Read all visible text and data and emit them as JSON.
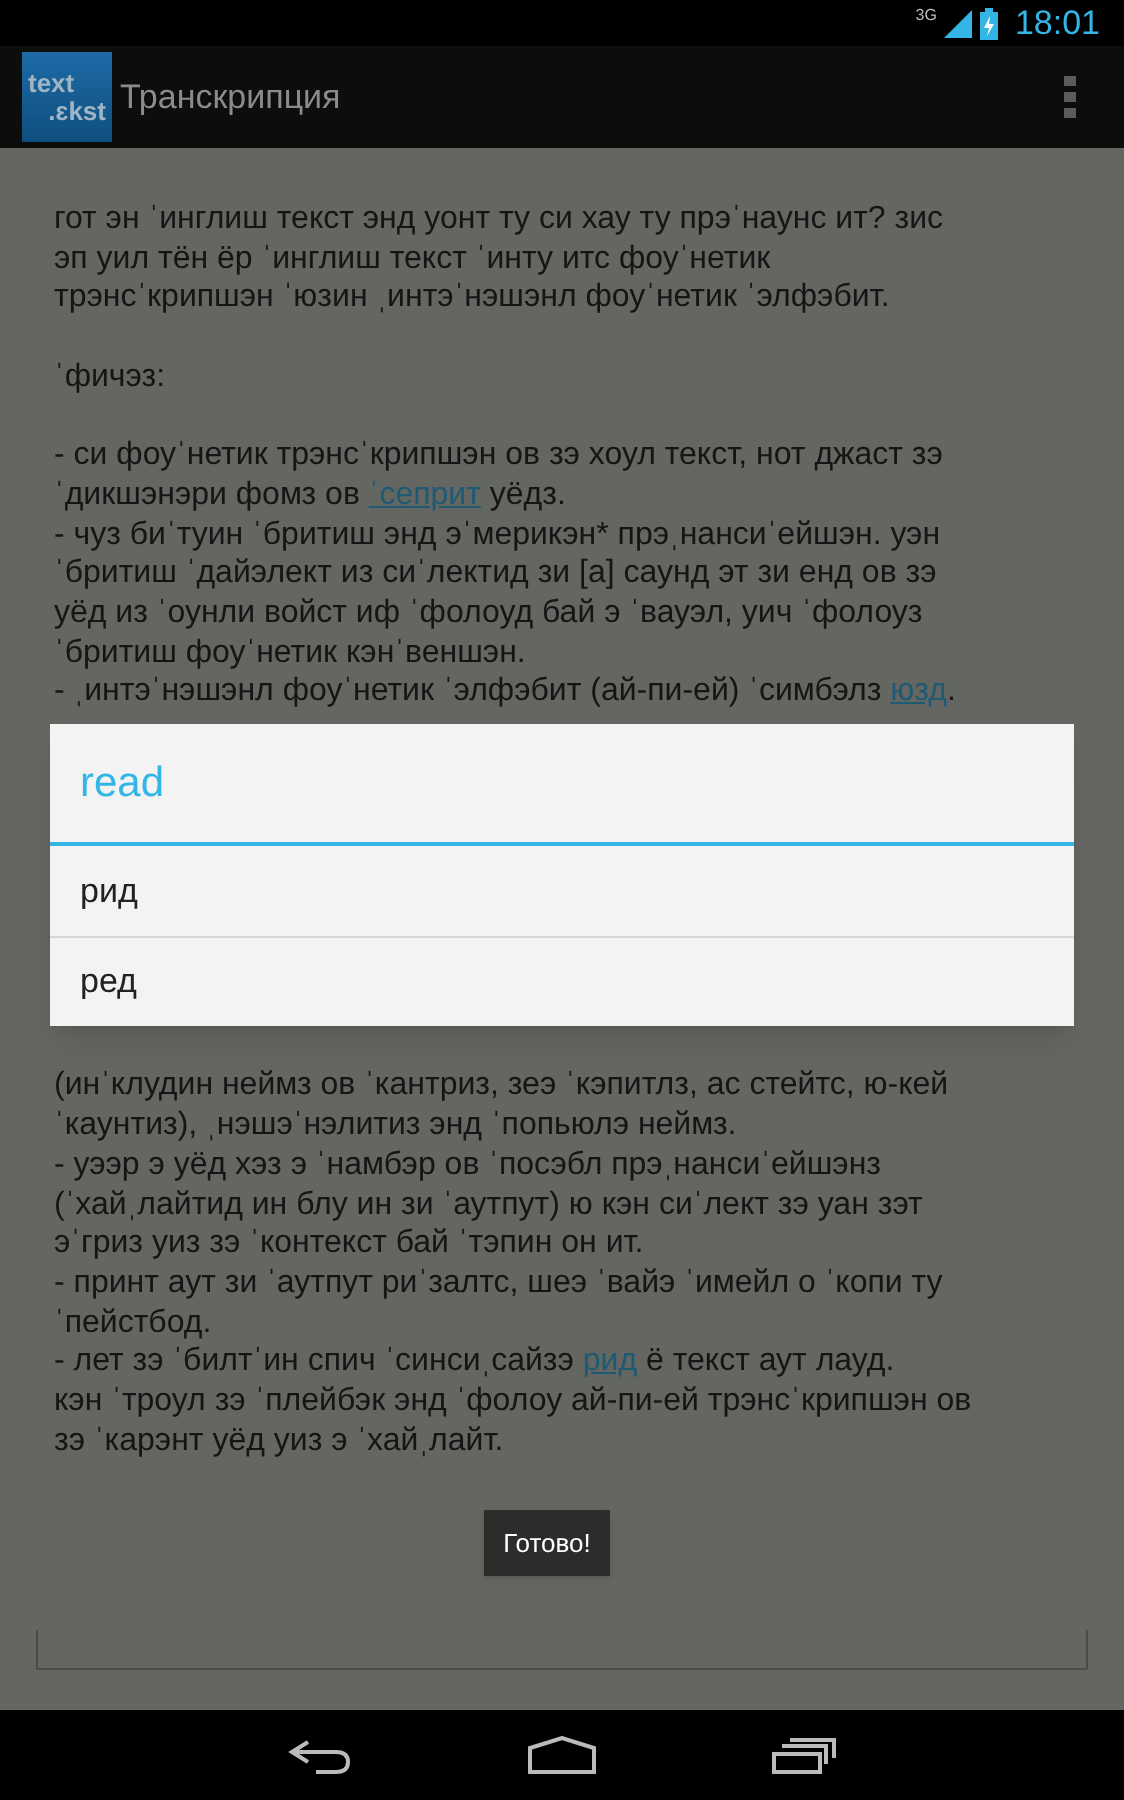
{
  "status_bar": {
    "network": "3G",
    "time": "18:01"
  },
  "action_bar": {
    "logo": [
      "text",
      ".ɛkst"
    ],
    "title": "Транскрипция"
  },
  "content": {
    "top_paragraphs": [
      [
        [
          {
            "kind": "text",
            "text": "гот эн ˈинглиш текст энд уонт ту си хау ту прэˈнаунс ит? зис"
          }
        ],
        [
          {
            "kind": "text",
            "text": "эп уил тён ёр ˈинглиш текст ˈинту итс фоуˈнетик"
          }
        ],
        [
          {
            "kind": "text",
            "text": "трэнсˈкрипшэн ˈюзин ˌинтэˈнэшэнл фоуˈнетик ˈэлфэбит."
          }
        ]
      ],
      [
        [
          {
            "kind": "text",
            "text": "ˈфичэз:"
          }
        ]
      ],
      [
        [
          {
            "kind": "text",
            "text": "- си фоуˈнетик трэнсˈкрипшэн ов зэ хоул текст, нот джаст зэ"
          }
        ],
        [
          {
            "kind": "text",
            "text": "ˈдикшэнэри фомз ов "
          },
          {
            "kind": "link",
            "text": "ˈсеприт"
          },
          {
            "kind": "text",
            "text": " уёдз."
          }
        ],
        [
          {
            "kind": "text",
            "text": "- чуз биˈтуин ˈбритиш энд эˈмерикэн* прэˌнансиˈейшэн. уэн"
          }
        ],
        [
          {
            "kind": "text",
            "text": "ˈбритиш ˈдайэлект из сиˈлектид зи [а] саунд эт зи енд ов зэ"
          }
        ],
        [
          {
            "kind": "text",
            "text": "уёд из ˈоунли войст иф ˈфолоуд бай э ˈвауэл, уич ˈфолоуз"
          }
        ],
        [
          {
            "kind": "text",
            "text": "ˈбритиш фоуˈнетик кэнˈвеншэн."
          }
        ],
        [
          {
            "kind": "text",
            "text": "- ˌинтэˈнэшэнл фоуˈнетик ˈэлфэбит (ай-пи-ей) ˈсимбэлз "
          },
          {
            "kind": "link",
            "text": "юзд"
          },
          {
            "kind": "text",
            "text": "."
          }
        ]
      ]
    ],
    "bottom_paragraphs": [
      [
        [
          {
            "kind": "text",
            "text": "(инˈклудин неймз ов ˈкантриз, зеэ ˈкэпитлз, ас стейтс, ю-кей"
          }
        ],
        [
          {
            "kind": "text",
            "text": "ˈкаунтиз), ˌнэшэˈнэлитиз энд ˈпопьюлэ неймз."
          }
        ],
        [
          {
            "kind": "text",
            "text": "- уээр э уёд хэз э ˈнамбэр ов ˈпосэбл прэˌнансиˈейшэнз"
          }
        ],
        [
          {
            "kind": "text",
            "text": "(ˈхайˌлайтид ин блу ин зи ˈаутпут) ю кэн сиˈлект зэ уан зэт"
          }
        ],
        [
          {
            "kind": "text",
            "text": "эˈгриз уиз зэ ˈконтекст бай ˈтэпин он ит."
          }
        ],
        [
          {
            "kind": "text",
            "text": "- принт аут зи ˈаутпут риˈзалтс, шеэ ˈвайэ ˈимейл о ˈкопи ту"
          }
        ],
        [
          {
            "kind": "text",
            "text": "ˈпейстбод."
          }
        ],
        [
          {
            "kind": "text",
            "text": "- лет зэ ˈбилтˈин спич ˈсинсиˌсайзэ "
          },
          {
            "kind": "link",
            "text": "рид"
          },
          {
            "kind": "text",
            "text": " ё текст аут лауд."
          }
        ],
        [
          {
            "kind": "text",
            "text": "кэн ˈтроул зэ ˈплейбэк энд ˈфолоу ай-пи-ей трэнсˈкрипшэн ов"
          }
        ],
        [
          {
            "kind": "text",
            "text": "зэ ˈкарэнт уёд уиз э ˈхайˌлайт."
          }
        ]
      ]
    ]
  },
  "dialog": {
    "title": "read",
    "options": [
      {
        "label": "рид"
      },
      {
        "label": "ред"
      }
    ]
  },
  "toast": {
    "text": "Готово!"
  }
}
